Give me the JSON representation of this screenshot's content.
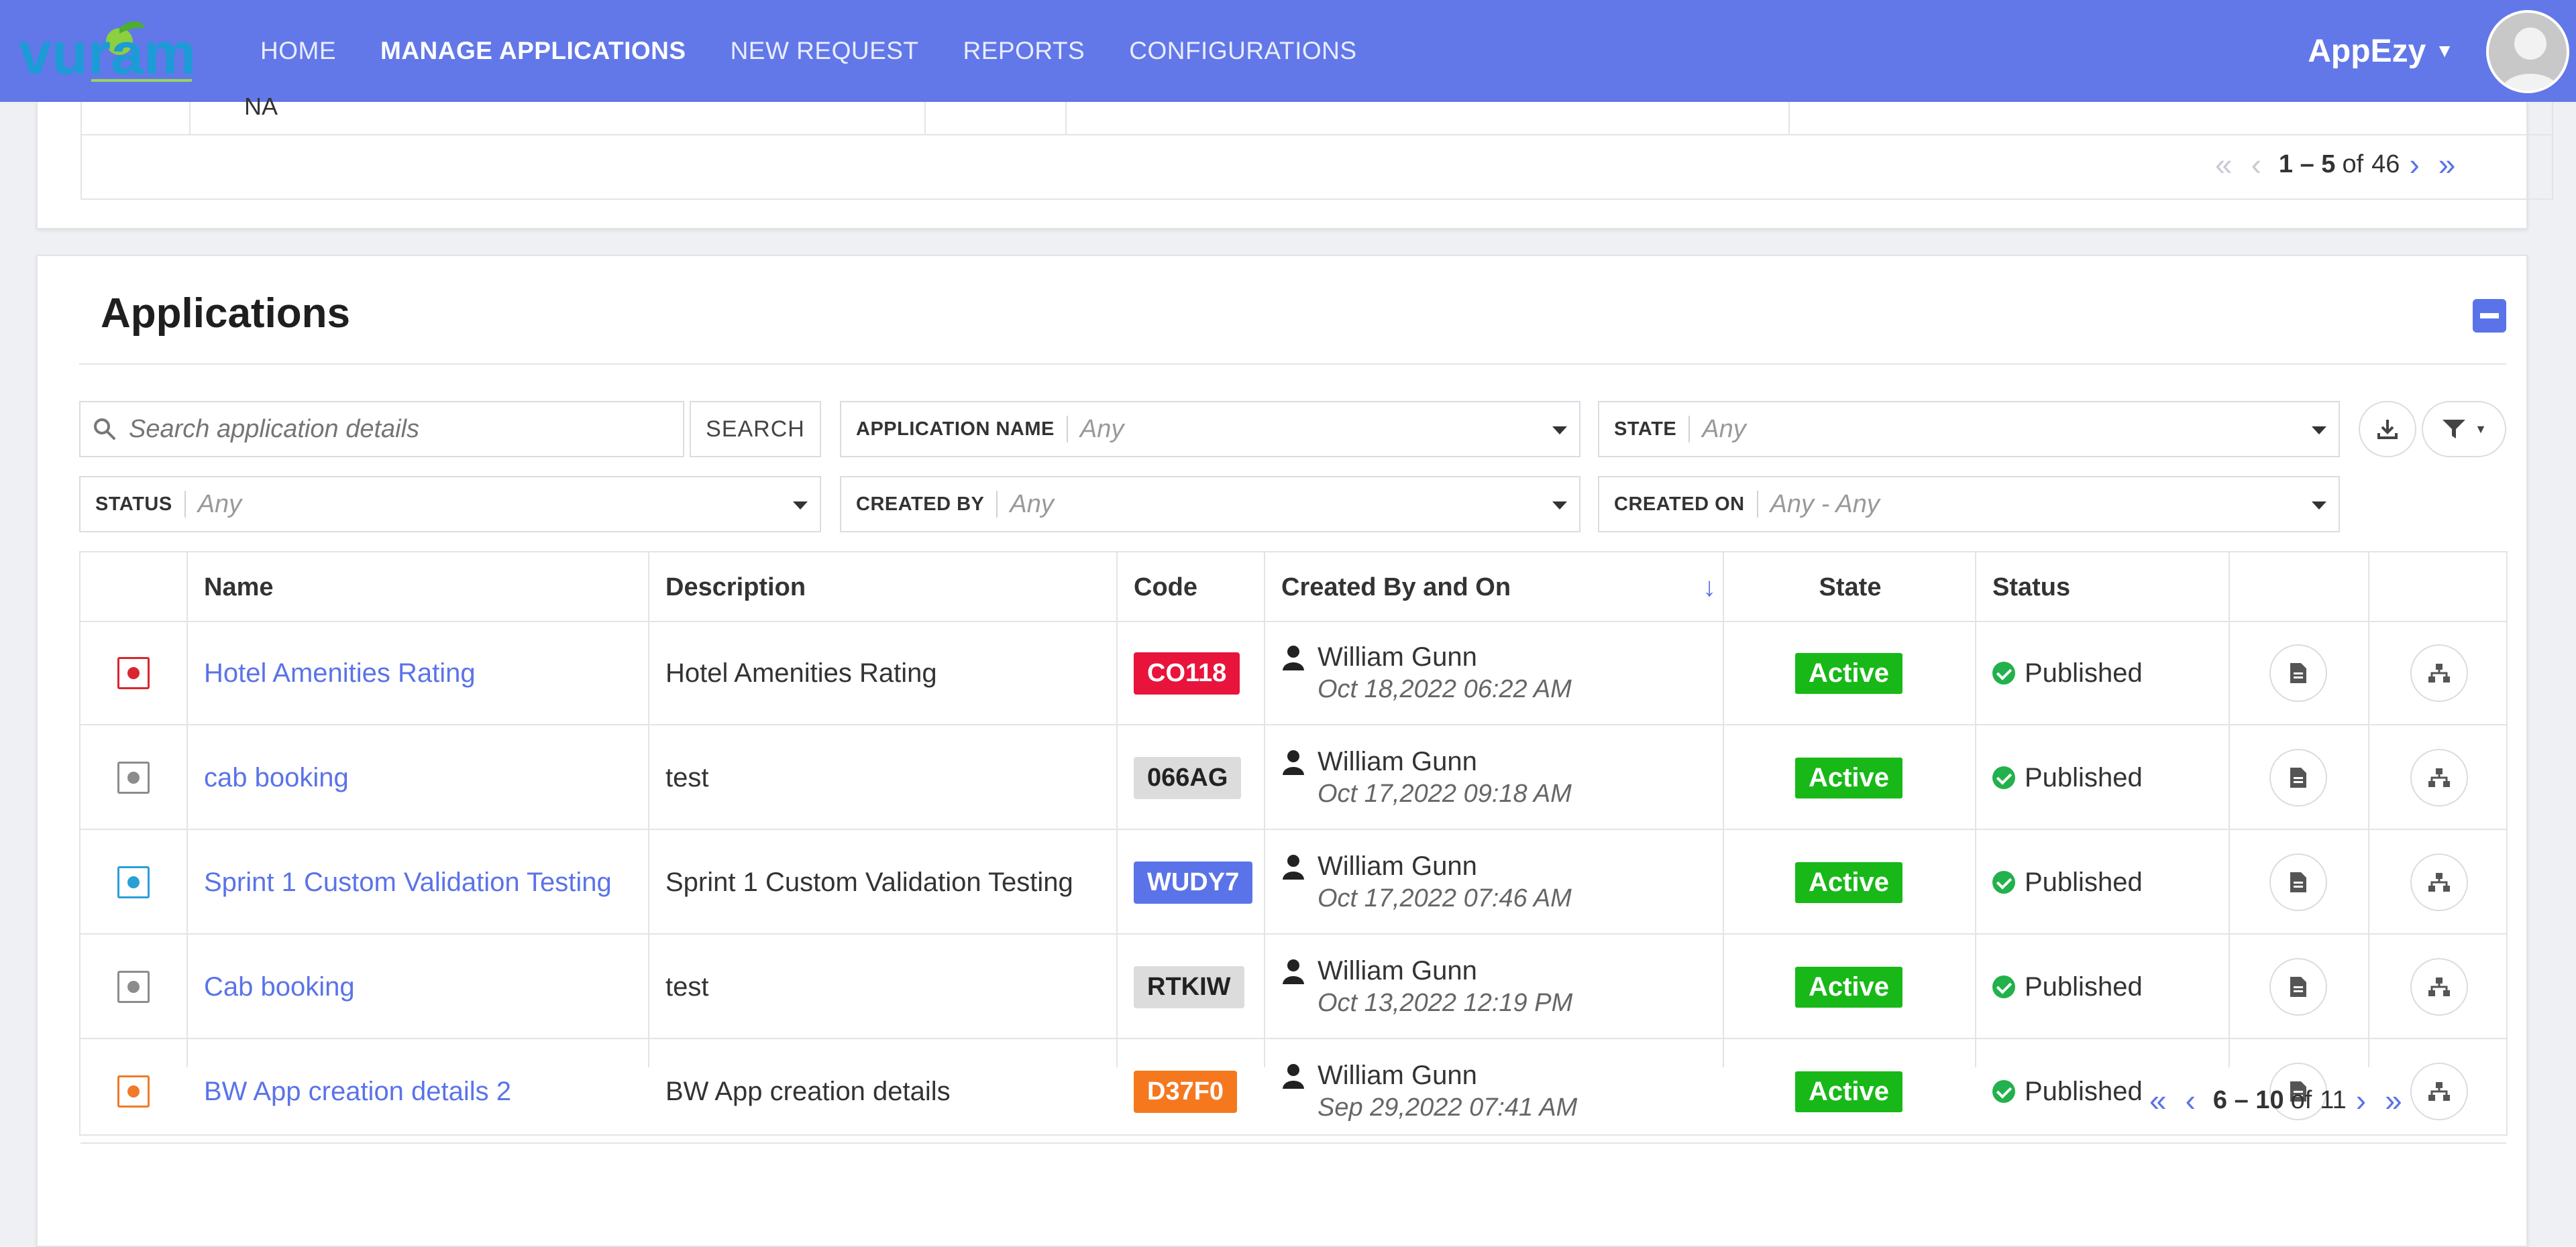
{
  "brand": {
    "logo_text": "vuram"
  },
  "nav": {
    "items": [
      "HOME",
      "MANAGE APPLICATIONS",
      "NEW REQUEST",
      "REPORTS",
      "CONFIGURATIONS"
    ],
    "active_index": 1
  },
  "user": {
    "name": "AppEzy"
  },
  "top_section": {
    "na_text": "NA",
    "pager": {
      "range": "1 – 5",
      "of_label": "of",
      "total": "46"
    }
  },
  "applications": {
    "title": "Applications",
    "search": {
      "placeholder": "Search application details",
      "button": "SEARCH"
    },
    "filters": {
      "application_name": {
        "label": "APPLICATION NAME",
        "value": "Any"
      },
      "state": {
        "label": "STATE",
        "value": "Any"
      },
      "status": {
        "label": "STATUS",
        "value": "Any"
      },
      "created_by": {
        "label": "CREATED BY",
        "value": "Any"
      },
      "created_on": {
        "label": "CREATED ON",
        "value": "Any - Any"
      }
    },
    "columns": [
      "Name",
      "Description",
      "Code",
      "Created By and On",
      "State",
      "Status"
    ],
    "rows": [
      {
        "icon": "person-form-icon",
        "icon_color": "#d9262e",
        "name": "Hotel Amenities Rating",
        "description": "Hotel Amenities Rating",
        "code": "CO118",
        "code_bg": "#e8143c",
        "code_fg": "#ffffff",
        "created_by": "William Gunn",
        "created_on": "Oct 18,2022 06:22 AM",
        "state": "Active",
        "status": "Published"
      },
      {
        "icon": "question-icon",
        "icon_color": "#8c8c8c",
        "name": "cab booking",
        "description": "test",
        "code": "066AG",
        "code_bg": "#dcdcdc",
        "code_fg": "#222222",
        "created_by": "William Gunn",
        "created_on": "Oct 17,2022 09:18 AM",
        "state": "Active",
        "status": "Published"
      },
      {
        "icon": "pencil-icon",
        "icon_color": "#2a9fd6",
        "name": "Sprint 1 Custom Validation Testing",
        "description": "Sprint 1 Custom Validation Testing",
        "code": "WUDY7",
        "code_bg": "#5b73e8",
        "code_fg": "#ffffff",
        "created_by": "William Gunn",
        "created_on": "Oct 17,2022 07:46 AM",
        "state": "Active",
        "status": "Published"
      },
      {
        "icon": "question-icon",
        "icon_color": "#8c8c8c",
        "name": "Cab booking",
        "description": "test",
        "code": "RTKIW",
        "code_bg": "#dcdcdc",
        "code_fg": "#222222",
        "created_by": "William Gunn",
        "created_on": "Oct 13,2022 12:19 PM",
        "state": "Active",
        "status": "Published"
      },
      {
        "icon": "chart-line-icon",
        "icon_color": "#f07a2a",
        "name": "BW App creation details 2",
        "description": "BW App creation details",
        "code": "D37F0",
        "code_bg": "#f5781f",
        "code_fg": "#ffffff",
        "created_by": "William Gunn",
        "created_on": "Sep 29,2022 07:41 AM",
        "state": "Active",
        "status": "Published"
      }
    ],
    "pager": {
      "range": "6 – 10",
      "of_label": "of",
      "total": "11"
    }
  },
  "colors": {
    "primary": "#6278e8",
    "accent": "#5b73e8",
    "active_green": "#18b818",
    "published_green": "#22b14c"
  }
}
